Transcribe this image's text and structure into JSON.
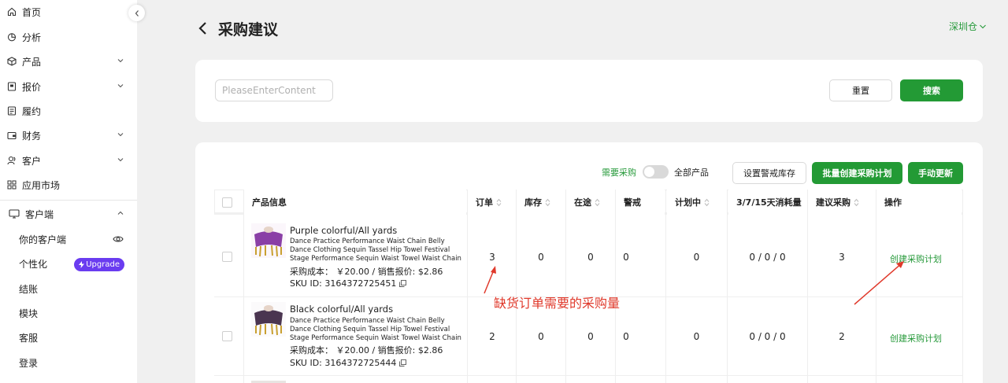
{
  "sidebar": {
    "items": [
      {
        "label": "首页",
        "icon": "home-icon"
      },
      {
        "label": "分析",
        "icon": "analytics-icon"
      },
      {
        "label": "产品",
        "icon": "product-icon",
        "has_chevron": true
      },
      {
        "label": "报价",
        "icon": "quote-icon",
        "has_chevron": true
      },
      {
        "label": "履约",
        "icon": "fulfillment-icon"
      },
      {
        "label": "财务",
        "icon": "wallet-icon",
        "has_chevron": true
      },
      {
        "label": "客户",
        "icon": "customer-icon",
        "has_chevron": true
      },
      {
        "label": "应用市场",
        "icon": "app-market-icon"
      }
    ],
    "client_section": {
      "label": "客户端",
      "icon": "monitor-icon",
      "expanded": true,
      "sub_items": [
        {
          "label": "你的客户端",
          "extra": "eye-icon"
        },
        {
          "label": "个性化",
          "badge": "Upgrade"
        },
        {
          "label": "结账"
        },
        {
          "label": "模块"
        },
        {
          "label": "客服"
        },
        {
          "label": "登录"
        }
      ]
    }
  },
  "header": {
    "title": "采购建议",
    "warehouse": "深圳仓"
  },
  "search": {
    "placeholder": "PleaseEnterContent",
    "reset_label": "重置",
    "search_label": "搜索"
  },
  "toolbar": {
    "toggle_left": "需要采购",
    "toggle_right": "全部产品",
    "toggle_on": false,
    "set_alert_label": "设置警戒库存",
    "batch_create_label": "批量创建采购计划",
    "manual_update_label": "手动更新"
  },
  "table": {
    "columns": [
      "产品信息",
      "订单",
      "库存",
      "在途",
      "警戒",
      "计划中",
      "3/7/15天消耗量",
      "建议采购",
      "操作"
    ],
    "rows": [
      {
        "name": "Purple colorful/All yards",
        "description": "Dance Practice Performance Waist Chain Belly Dance Clothing Sequin Tassel Hip Towel Festival Stage Performance Sequin Waist Towel Waist Chain",
        "price": "采购成本： ￥20.00 / 销售报价:   $2.86",
        "sku": "SKU ID: 3164372725451",
        "order": "3",
        "stock": "0",
        "in_transit": "0",
        "alert": "0",
        "planned": "0",
        "consumption": "0 / 0 / 0",
        "suggested": "3",
        "action": "创建采购计划",
        "thumb_color": "#8a3fa6"
      },
      {
        "name": "Black colorful/All yards",
        "description": "Dance Practice Performance Waist Chain Belly Dance Clothing Sequin Tassel Hip Towel Festival Stage Performance Sequin Waist Towel Waist Chain",
        "price": "采购成本： ￥20.00 / 销售报价:   $2.86",
        "sku": "SKU ID: 3164372725444",
        "order": "2",
        "stock": "0",
        "in_transit": "0",
        "alert": "0",
        "planned": "0",
        "consumption": "0 / 0 / 0",
        "suggested": "2",
        "action": "创建采购计划",
        "thumb_color": "#4a3550"
      }
    ]
  },
  "annotation": {
    "text": "缺货订单需要的采购量",
    "color": "#e0392b"
  },
  "colors": {
    "accent": "#239a35",
    "link": "#279a3b",
    "upgrade": "#6a3cf0"
  }
}
